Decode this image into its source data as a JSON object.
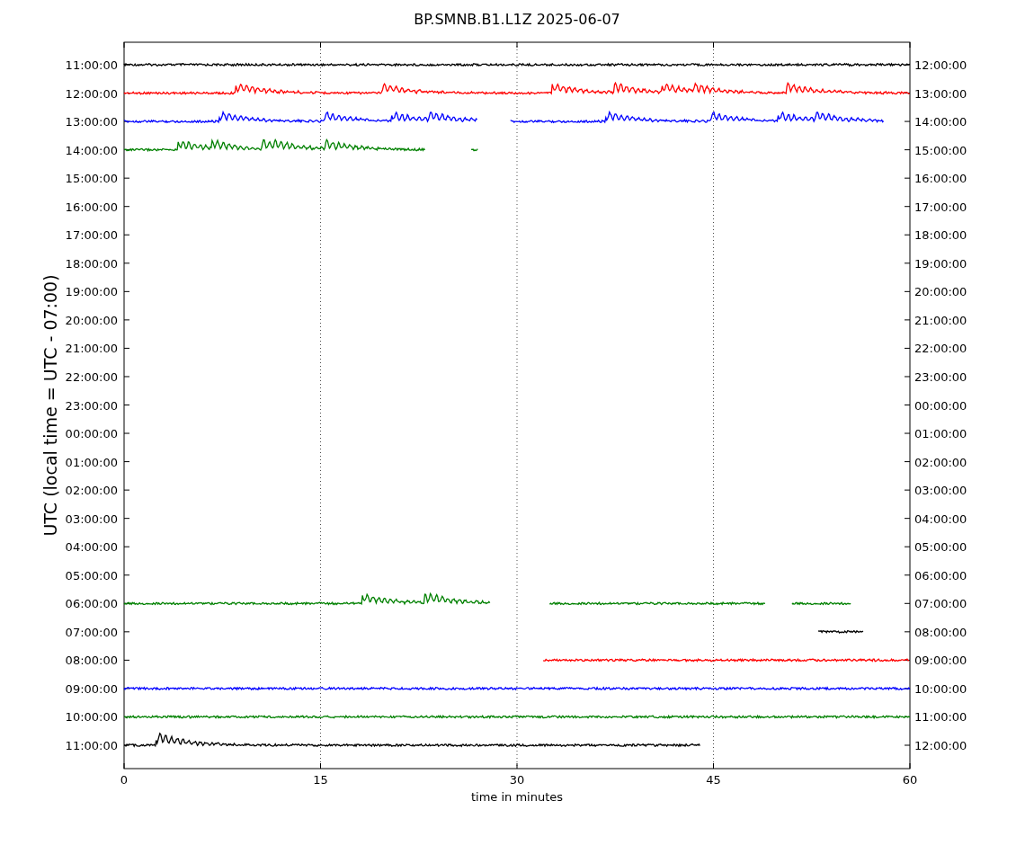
{
  "title": "BP.SMNB.B1.L1Z 2025-06-07",
  "ylabel": "UTC (local time = UTC - 07:00)",
  "xlabel": "time in minutes",
  "xticks": [
    "0",
    "15",
    "30",
    "45",
    "60"
  ],
  "rows": [
    {
      "utc": "11:00:00",
      "local": "12:00:00",
      "color": "#000000"
    },
    {
      "utc": "12:00:00",
      "local": "13:00:00",
      "color": "#ff0000"
    },
    {
      "utc": "13:00:00",
      "local": "14:00:00",
      "color": "#0000ff"
    },
    {
      "utc": "14:00:00",
      "local": "15:00:00",
      "color": "#008000"
    },
    {
      "utc": "15:00:00",
      "local": "16:00:00"
    },
    {
      "utc": "16:00:00",
      "local": "17:00:00"
    },
    {
      "utc": "17:00:00",
      "local": "18:00:00"
    },
    {
      "utc": "18:00:00",
      "local": "19:00:00"
    },
    {
      "utc": "19:00:00",
      "local": "20:00:00"
    },
    {
      "utc": "20:00:00",
      "local": "21:00:00"
    },
    {
      "utc": "21:00:00",
      "local": "22:00:00"
    },
    {
      "utc": "22:00:00",
      "local": "23:00:00"
    },
    {
      "utc": "23:00:00",
      "local": "00:00:00"
    },
    {
      "utc": "00:00:00",
      "local": "01:00:00"
    },
    {
      "utc": "01:00:00",
      "local": "02:00:00"
    },
    {
      "utc": "02:00:00",
      "local": "03:00:00"
    },
    {
      "utc": "03:00:00",
      "local": "04:00:00"
    },
    {
      "utc": "04:00:00",
      "local": "05:00:00"
    },
    {
      "utc": "05:00:00",
      "local": "06:00:00"
    },
    {
      "utc": "06:00:00",
      "local": "07:00:00",
      "color": "#008000"
    },
    {
      "utc": "07:00:00",
      "local": "08:00:00",
      "color": "#000000"
    },
    {
      "utc": "08:00:00",
      "local": "09:00:00",
      "color": "#ff0000"
    },
    {
      "utc": "09:00:00",
      "local": "10:00:00",
      "color": "#0000ff"
    },
    {
      "utc": "10:00:00",
      "local": "11:00:00",
      "color": "#008000"
    },
    {
      "utc": "11:00:00",
      "local": "12:00:00",
      "color": "#000000"
    }
  ]
}
